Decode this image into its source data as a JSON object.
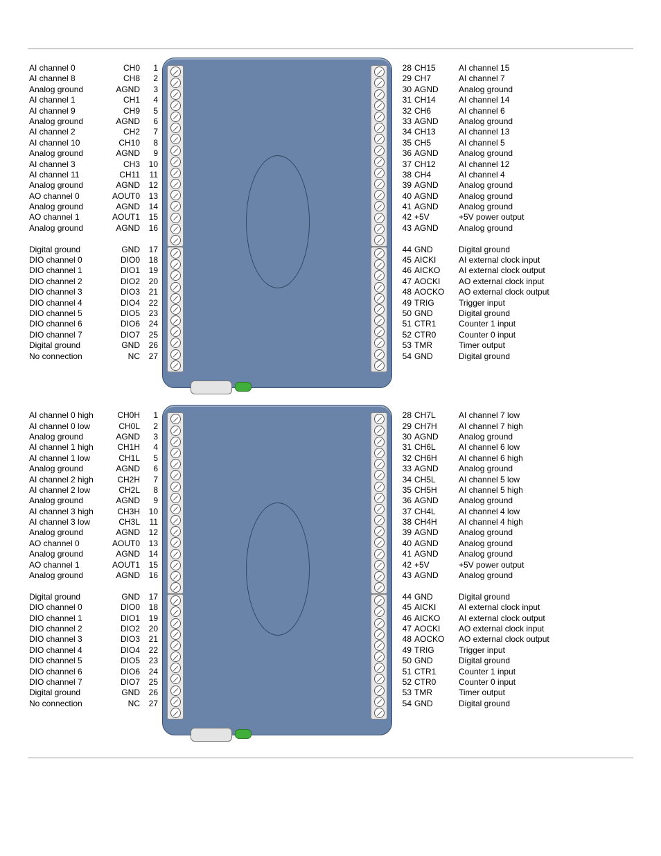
{
  "diagrams": [
    {
      "left": [
        {
          "label": "AI channel 0",
          "code": "CH0",
          "num": "1"
        },
        {
          "label": "AI channel 8",
          "code": "CH8",
          "num": "2"
        },
        {
          "label": "Analog ground",
          "code": "AGND",
          "num": "3"
        },
        {
          "label": "AI channel 1",
          "code": "CH1",
          "num": "4"
        },
        {
          "label": "AI channel 9",
          "code": "CH9",
          "num": "5"
        },
        {
          "label": "Analog ground",
          "code": "AGND",
          "num": "6"
        },
        {
          "label": "AI channel 2",
          "code": "CH2",
          "num": "7"
        },
        {
          "label": "AI channel 10",
          "code": "CH10",
          "num": "8"
        },
        {
          "label": "Analog ground",
          "code": "AGND",
          "num": "9"
        },
        {
          "label": "AI channel 3",
          "code": "CH3",
          "num": "10"
        },
        {
          "label": "AI channel 11",
          "code": "CH11",
          "num": "11"
        },
        {
          "label": "Analog ground",
          "code": "AGND",
          "num": "12"
        },
        {
          "label": "AO channel 0",
          "code": "AOUT0",
          "num": "13"
        },
        {
          "label": "Analog ground",
          "code": "AGND",
          "num": "14"
        },
        {
          "label": "AO channel 1",
          "code": "AOUT1",
          "num": "15"
        },
        {
          "label": "Analog ground",
          "code": "AGND",
          "num": "16"
        },
        null,
        {
          "label": "Digital ground",
          "code": "GND",
          "num": "17"
        },
        {
          "label": "DIO channel 0",
          "code": "DIO0",
          "num": "18"
        },
        {
          "label": "DIO channel 1",
          "code": "DIO1",
          "num": "19"
        },
        {
          "label": "DIO channel 2",
          "code": "DIO2",
          "num": "20"
        },
        {
          "label": "DIO channel 3",
          "code": "DIO3",
          "num": "21"
        },
        {
          "label": "DIO channel 4",
          "code": "DIO4",
          "num": "22"
        },
        {
          "label": "DIO channel 5",
          "code": "DIO5",
          "num": "23"
        },
        {
          "label": "DIO channel 6",
          "code": "DIO6",
          "num": "24"
        },
        {
          "label": "DIO channel 7",
          "code": "DIO7",
          "num": "25"
        },
        {
          "label": "Digital ground",
          "code": "GND",
          "num": "26"
        },
        {
          "label": "No connection",
          "code": "NC",
          "num": "27"
        }
      ],
      "right": [
        {
          "num": "28",
          "code": "CH15",
          "label": "AI channel 15"
        },
        {
          "num": "29",
          "code": "CH7",
          "label": "AI channel 7"
        },
        {
          "num": "30",
          "code": "AGND",
          "label": "Analog ground"
        },
        {
          "num": "31",
          "code": "CH14",
          "label": "AI channel 14"
        },
        {
          "num": "32",
          "code": "CH6",
          "label": "AI channel 6"
        },
        {
          "num": "33",
          "code": "AGND",
          "label": "Analog ground"
        },
        {
          "num": "34",
          "code": "CH13",
          "label": "AI channel 13"
        },
        {
          "num": "35",
          "code": "CH5",
          "label": "AI channel 5"
        },
        {
          "num": "36",
          "code": "AGND",
          "label": "Analog ground"
        },
        {
          "num": "37",
          "code": "CH12",
          "label": "AI channel 12"
        },
        {
          "num": "38",
          "code": "CH4",
          "label": "AI channel 4"
        },
        {
          "num": "39",
          "code": "AGND",
          "label": "Analog ground"
        },
        {
          "num": "40",
          "code": "AGND",
          "label": "Analog ground"
        },
        {
          "num": "41",
          "code": "AGND",
          "label": "Analog ground"
        },
        {
          "num": "42",
          "code": "+5V",
          "label": "+5V power output"
        },
        {
          "num": "43",
          "code": "AGND",
          "label": "Analog ground"
        },
        null,
        {
          "num": "44",
          "code": "GND",
          "label": "Digital ground"
        },
        {
          "num": "45",
          "code": "AICKI",
          "label": "AI external clock input"
        },
        {
          "num": "46",
          "code": "AICKO",
          "label": "AI external  clock output"
        },
        {
          "num": "47",
          "code": "AOCKI",
          "label": "AO external clock input"
        },
        {
          "num": "48",
          "code": "AOCKO",
          "label": "AO external clock output"
        },
        {
          "num": "49",
          "code": "TRIG",
          "label": "Trigger input"
        },
        {
          "num": "50",
          "code": "GND",
          "label": "Digital ground"
        },
        {
          "num": "51",
          "code": "CTR1",
          "label": "Counter 1 input"
        },
        {
          "num": "52",
          "code": "CTR0",
          "label": "Counter 0 input"
        },
        {
          "num": "53",
          "code": "TMR",
          "label": "Timer output"
        },
        {
          "num": "54",
          "code": "GND",
          "label": "Digital ground"
        }
      ]
    },
    {
      "left": [
        {
          "label": "AI channel 0 high",
          "code": "CH0H",
          "num": "1"
        },
        {
          "label": "AI channel 0 low",
          "code": "CH0L",
          "num": "2"
        },
        {
          "label": "Analog ground",
          "code": "AGND",
          "num": "3"
        },
        {
          "label": "AI channel 1 high",
          "code": "CH1H",
          "num": "4"
        },
        {
          "label": "AI channel 1 low",
          "code": "CH1L",
          "num": "5"
        },
        {
          "label": "Analog ground",
          "code": "AGND",
          "num": "6"
        },
        {
          "label": "AI channel 2 high",
          "code": "CH2H",
          "num": "7"
        },
        {
          "label": "AI channel 2 low",
          "code": "CH2L",
          "num": "8"
        },
        {
          "label": "Analog ground",
          "code": "AGND",
          "num": "9"
        },
        {
          "label": "AI channel 3 high",
          "code": "CH3H",
          "num": "10"
        },
        {
          "label": "AI channel 3 low",
          "code": "CH3L",
          "num": "11"
        },
        {
          "label": "Analog ground",
          "code": "AGND",
          "num": "12"
        },
        {
          "label": "AO channel 0",
          "code": "AOUT0",
          "num": "13"
        },
        {
          "label": "Analog ground",
          "code": "AGND",
          "num": "14"
        },
        {
          "label": "AO channel 1",
          "code": "AOUT1",
          "num": "15"
        },
        {
          "label": "Analog ground",
          "code": "AGND",
          "num": "16"
        },
        null,
        {
          "label": "Digital ground",
          "code": "GND",
          "num": "17"
        },
        {
          "label": "DIO channel 0",
          "code": "DIO0",
          "num": "18"
        },
        {
          "label": "DIO channel 1",
          "code": "DIO1",
          "num": "19"
        },
        {
          "label": "DIO channel 2",
          "code": "DIO2",
          "num": "20"
        },
        {
          "label": "DIO channel 3",
          "code": "DIO3",
          "num": "21"
        },
        {
          "label": "DIO channel 4",
          "code": "DIO4",
          "num": "22"
        },
        {
          "label": "DIO channel 5",
          "code": "DIO5",
          "num": "23"
        },
        {
          "label": "DIO channel 6",
          "code": "DIO6",
          "num": "24"
        },
        {
          "label": "DIO channel 7",
          "code": "DIO7",
          "num": "25"
        },
        {
          "label": "Digital ground",
          "code": "GND",
          "num": "26"
        },
        {
          "label": "No connection",
          "code": "NC",
          "num": "27"
        }
      ],
      "right": [
        {
          "num": "28",
          "code": "CH7L",
          "label": "AI channel 7 low"
        },
        {
          "num": "29",
          "code": "CH7H",
          "label": "AI channel 7 high"
        },
        {
          "num": "30",
          "code": "AGND",
          "label": "Analog ground"
        },
        {
          "num": "31",
          "code": "CH6L",
          "label": "AI channel 6 low"
        },
        {
          "num": "32",
          "code": "CH6H",
          "label": "AI channel 6 high"
        },
        {
          "num": "33",
          "code": "AGND",
          "label": "Analog ground"
        },
        {
          "num": "34",
          "code": "CH5L",
          "label": "AI channel 5 low"
        },
        {
          "num": "35",
          "code": "CH5H",
          "label": "AI channel 5 high"
        },
        {
          "num": "36",
          "code": "AGND",
          "label": "Analog ground"
        },
        {
          "num": "37",
          "code": "CH4L",
          "label": "AI channel 4 low"
        },
        {
          "num": "38",
          "code": "CH4H",
          "label": "AI channel 4 high"
        },
        {
          "num": "39",
          "code": "AGND",
          "label": "Analog ground"
        },
        {
          "num": "40",
          "code": "AGND",
          "label": "Analog ground"
        },
        {
          "num": "41",
          "code": "AGND",
          "label": "Analog ground"
        },
        {
          "num": "42",
          "code": "+5V",
          "label": "+5V power output"
        },
        {
          "num": "43",
          "code": "AGND",
          "label": "Analog ground"
        },
        null,
        {
          "num": "44",
          "code": "GND",
          "label": "Digital ground"
        },
        {
          "num": "45",
          "code": "AICKI",
          "label": "AI external clock input"
        },
        {
          "num": "46",
          "code": "AICKO",
          "label": "AI external clock output"
        },
        {
          "num": "47",
          "code": "AOCKI",
          "label": "AO external clock input"
        },
        {
          "num": "48",
          "code": "AOCKO",
          "label": "AO external clock output"
        },
        {
          "num": "49",
          "code": "TRIG",
          "label": "Trigger input"
        },
        {
          "num": "50",
          "code": "GND",
          "label": "Digital ground"
        },
        {
          "num": "51",
          "code": "CTR1",
          "label": "Counter 1 input"
        },
        {
          "num": "52",
          "code": "CTR0",
          "label": "Counter 0 input"
        },
        {
          "num": "53",
          "code": "TMR",
          "label": "Timer output"
        },
        {
          "num": "54",
          "code": "GND",
          "label": "Digital ground"
        }
      ]
    }
  ]
}
